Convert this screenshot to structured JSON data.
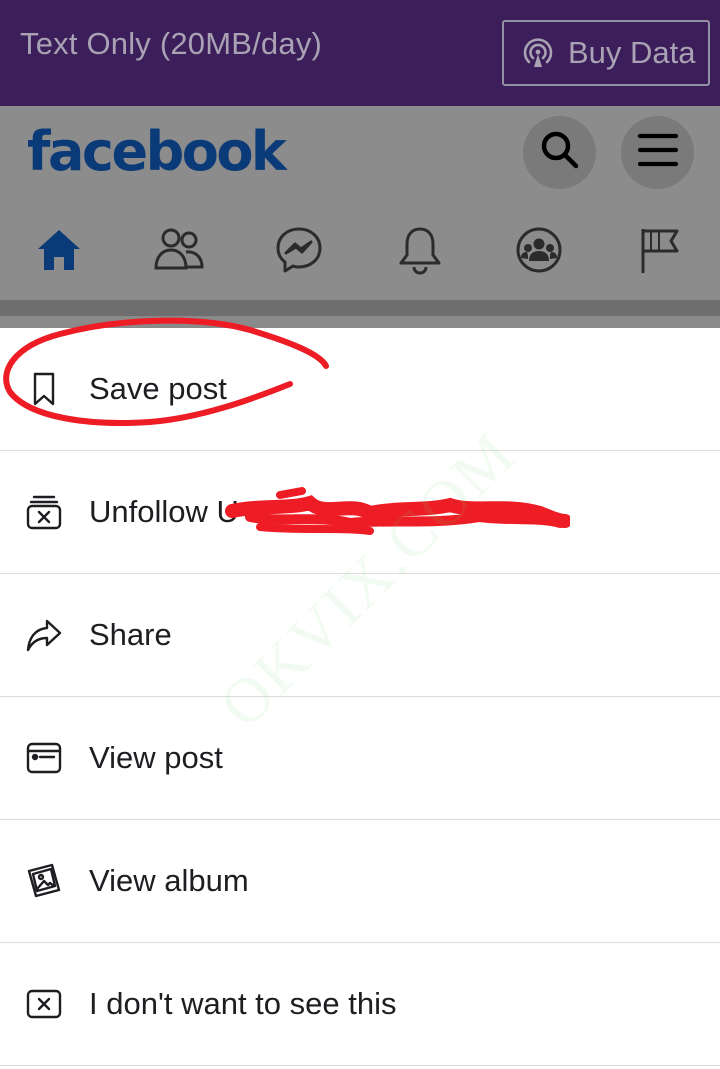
{
  "banner": {
    "text": "Text Only (20MB/day)",
    "buy_label": "Buy Data",
    "buy_icon": "signal-icon",
    "bg": "#3c1f5a"
  },
  "header": {
    "logo": "facebook",
    "search_icon": "search-icon",
    "menu_icon": "hamburger-icon",
    "nav": [
      "home-icon",
      "friends-icon",
      "messenger-icon",
      "bell-icon",
      "groups-icon",
      "flag-icon"
    ],
    "active_nav": "home-icon",
    "brand_color": "#0b3a78"
  },
  "menu": {
    "items": [
      {
        "label": "Save post",
        "icon": "bookmark-icon"
      },
      {
        "label": "Unfollow U",
        "icon": "unfollow-icon"
      },
      {
        "label": "Share",
        "icon": "share-icon"
      },
      {
        "label": "View post",
        "icon": "view-post-icon"
      },
      {
        "label": "View album",
        "icon": "album-icon"
      },
      {
        "label": "I don't want to see this",
        "icon": "hide-icon"
      }
    ]
  },
  "watermark": "OKVIX.COM",
  "annotation_color": "#ee1c24"
}
